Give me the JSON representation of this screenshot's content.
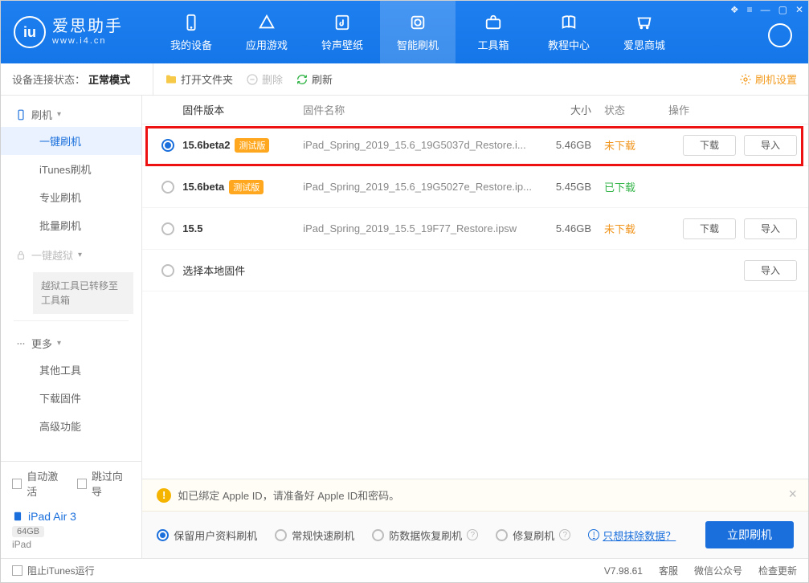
{
  "brand": {
    "title": "爱思助手",
    "sub": "www.i4.cn"
  },
  "nav": {
    "tabs": [
      {
        "label": "我的设备"
      },
      {
        "label": "应用游戏"
      },
      {
        "label": "铃声壁纸"
      },
      {
        "label": "智能刷机"
      },
      {
        "label": "工具箱"
      },
      {
        "label": "教程中心"
      },
      {
        "label": "爱思商城"
      }
    ]
  },
  "status_bar": {
    "label": "设备连接状态：",
    "value": "正常模式"
  },
  "toolbar": {
    "open_folder": "打开文件夹",
    "delete": "删除",
    "refresh": "刷新",
    "settings": "刷机设置"
  },
  "sidebar": {
    "groups": [
      {
        "title": "刷机",
        "items": [
          "一键刷机",
          "iTunes刷机",
          "专业刷机",
          "批量刷机"
        ],
        "active_index": 0
      },
      {
        "title": "一键越狱",
        "muted": true,
        "note": "越狱工具已转移至工具箱"
      },
      {
        "title": "更多",
        "items": [
          "其他工具",
          "下载固件",
          "高级功能"
        ]
      }
    ],
    "bottom": {
      "auto_activate": "自动激活",
      "skip_guide": "跳过向导"
    },
    "device": {
      "name": "iPad Air 3",
      "capacity": "64GB",
      "type": "iPad"
    }
  },
  "table": {
    "headers": {
      "version": "固件版本",
      "name": "固件名称",
      "size": "大小",
      "status": "状态",
      "ops": "操作"
    },
    "rows": [
      {
        "selected": true,
        "version": "15.6beta2",
        "beta": true,
        "name": "iPad_Spring_2019_15.6_19G5037d_Restore.i...",
        "size": "5.46GB",
        "status": "未下载",
        "status_cls": "not",
        "show_ops": true
      },
      {
        "selected": false,
        "version": "15.6beta",
        "beta": true,
        "name": "iPad_Spring_2019_15.6_19G5027e_Restore.ip...",
        "size": "5.45GB",
        "status": "已下载",
        "status_cls": "done",
        "show_ops": false
      },
      {
        "selected": false,
        "version": "15.5",
        "beta": false,
        "name": "iPad_Spring_2019_15.5_19F77_Restore.ipsw",
        "size": "5.46GB",
        "status": "未下载",
        "status_cls": "not",
        "show_ops": true
      }
    ],
    "local_row": {
      "label": "选择本地固件",
      "import": "导入"
    },
    "beta_badge": "测试版",
    "btn_download": "下载",
    "btn_import": "导入"
  },
  "bottom": {
    "warn": "如已绑定 Apple ID，请准备好 Apple ID和密码。",
    "options": [
      "保留用户资料刷机",
      "常规快速刷机",
      "防数据恢复刷机",
      "修复刷机"
    ],
    "erase_link": "只想抹除数据？",
    "flash_btn": "立即刷机"
  },
  "footer": {
    "block_itunes": "阻止iTunes运行",
    "version": "V7.98.61",
    "links": [
      "客服",
      "微信公众号",
      "检查更新"
    ]
  }
}
